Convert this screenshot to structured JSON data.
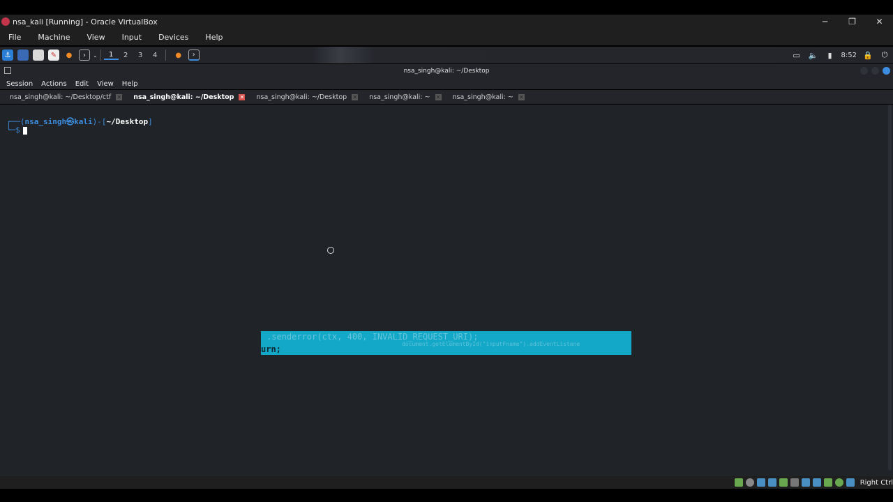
{
  "vbox": {
    "title": "nsa_kali [Running] - Oracle VirtualBox",
    "menu": [
      "File",
      "Machine",
      "View",
      "Input",
      "Devices",
      "Help"
    ],
    "host_key": "Right Ctrl"
  },
  "panel": {
    "workspaces": [
      "1",
      "2",
      "3",
      "4"
    ],
    "active_workspace": "1",
    "clock": "8:52"
  },
  "terminal": {
    "window_title": "nsa_singh@kali: ~/Desktop",
    "menu": [
      "Session",
      "Actions",
      "Edit",
      "View",
      "Help"
    ],
    "tabs": [
      {
        "label": "nsa_singh@kali: ~/Desktop/ctf",
        "active": false
      },
      {
        "label": "nsa_singh@kali: ~/Desktop",
        "active": true
      },
      {
        "label": "nsa_singh@kali: ~/Desktop",
        "active": false
      },
      {
        "label": "nsa_singh@kali: ~",
        "active": false
      },
      {
        "label": "nsa_singh@kali: ~",
        "active": false
      }
    ],
    "prompt": {
      "user": "nsa_singh",
      "host": "kali",
      "path": "~/Desktop",
      "symbol": "$"
    }
  },
  "overlay": {
    "line1": ".senderror(ctx, 400, INVALID_REQUEST_URI);",
    "line2": "document.getElementById(\"inputFname\").addEventListene",
    "line3": "urn;"
  },
  "colors": {
    "accent": "#3d8ee0",
    "terminal_bg": "#202328",
    "overlay_bg": "#13a7c8",
    "active_tab_close": "#d9534f"
  }
}
